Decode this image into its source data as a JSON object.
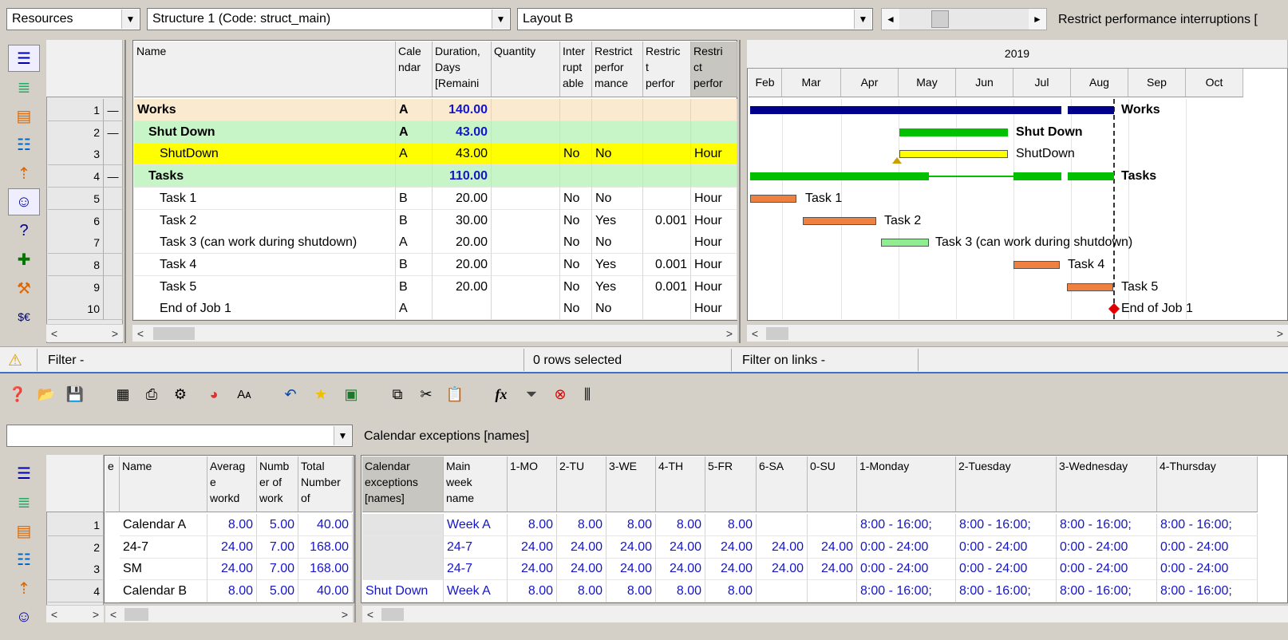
{
  "top": {
    "resources_combo": "Resources",
    "structure_combo": "Structure 1 (Code: struct_main)",
    "layout_combo": "Layout B",
    "restrict_label": "Restrict performance interruptions ["
  },
  "grid1": {
    "headers": [
      "Name",
      "Cale\nndar",
      "Duration,\nDays\n[Remaini",
      "Quantity",
      "Inter\nrupt\nable",
      "Restrict\nperfor\nmance",
      "Restric\nt\nperfor",
      "Restri\nct\nperfor"
    ],
    "rows": [
      {
        "n": "1",
        "c": "—",
        "name": "Works",
        "cal": "A",
        "dur": "140.00",
        "int": "",
        "rp": "",
        "rt": "",
        "unit": ""
      },
      {
        "n": "2",
        "c": "—",
        "name": "Shut Down",
        "cal": "A",
        "dur": "43.00",
        "int": "",
        "rp": "",
        "rt": "",
        "unit": ""
      },
      {
        "n": "3",
        "c": "",
        "name": "ShutDown",
        "cal": "A",
        "dur": "43.00",
        "int": "No",
        "rp": "No",
        "rt": "",
        "unit": "Hour"
      },
      {
        "n": "4",
        "c": "—",
        "name": "Tasks",
        "cal": "",
        "dur": "110.00",
        "int": "",
        "rp": "",
        "rt": "",
        "unit": ""
      },
      {
        "n": "5",
        "c": "",
        "name": "Task 1",
        "cal": "B",
        "dur": "20.00",
        "int": "No",
        "rp": "No",
        "rt": "",
        "unit": "Hour"
      },
      {
        "n": "6",
        "c": "",
        "name": "Task 2",
        "cal": "B",
        "dur": "30.00",
        "int": "No",
        "rp": "Yes",
        "rt": "0.001",
        "unit": "Hour"
      },
      {
        "n": "7",
        "c": "",
        "name": "Task 3 (can work during shutdown)",
        "cal": "A",
        "dur": "20.00",
        "int": "No",
        "rp": "No",
        "rt": "",
        "unit": "Hour"
      },
      {
        "n": "8",
        "c": "",
        "name": "Task 4",
        "cal": "B",
        "dur": "20.00",
        "int": "No",
        "rp": "Yes",
        "rt": "0.001",
        "unit": "Hour"
      },
      {
        "n": "9",
        "c": "",
        "name": "Task 5",
        "cal": "B",
        "dur": "20.00",
        "int": "No",
        "rp": "Yes",
        "rt": "0.001",
        "unit": "Hour"
      },
      {
        "n": "10",
        "c": "",
        "name": "End of Job 1",
        "cal": "A",
        "dur": "",
        "int": "No",
        "rp": "No",
        "rt": "",
        "unit": "Hour"
      }
    ]
  },
  "gantt": {
    "year": "2019",
    "months": [
      "Feb",
      "Mar",
      "Apr",
      "May",
      "Jun",
      "Jul",
      "Aug",
      "Sep",
      "Oct"
    ],
    "labels": [
      "Works",
      "Shut Down",
      "ShutDown",
      "Tasks",
      "Task 1",
      "Task 2",
      "Task 3 (can work during shutdown)",
      "Task 4",
      "Task 5",
      "End of Job 1"
    ],
    "colors": {
      "summary": "#00008b",
      "shutdown_summary": "#00c000",
      "shutdown": "#ffff00",
      "task": "#f08040",
      "task_green": "#90ee90",
      "milestone": "#e00000"
    }
  },
  "status": {
    "filter": "Filter -",
    "rows_selected": "0 rows selected",
    "filter_links": "Filter on links -"
  },
  "toolbar": {
    "icons": [
      "help-icon",
      "open-folder-icon",
      "save-icon",
      "table-icon",
      "print-icon",
      "tools-icon",
      "chart-pie-icon",
      "font-size-icon",
      "undo-icon",
      "star-icon",
      "excel-icon",
      "copy-icon",
      "cut-icon",
      "paste-icon",
      "formula-icon",
      "filter-icon",
      "clear-filter-icon",
      "columns-icon"
    ]
  },
  "bottom": {
    "combo_value": "",
    "combo_label": "Calendar exceptions [names]",
    "left_headers": [
      "e",
      "Name",
      "Averag\ne\nworkd",
      "Numb\ner of\nwork",
      "Total\nNumber\nof"
    ],
    "right_headers": [
      "Calendar\nexceptions\n[names]",
      "Main\nweek\nname",
      "1-MO",
      "2-TU",
      "3-WE",
      "4-TH",
      "5-FR",
      "6-SA",
      "0-SU",
      "1-Monday",
      "2-Tuesday",
      "3-Wednesday",
      "4-Thursday"
    ],
    "rows": [
      {
        "n": "1",
        "name": "Calendar A",
        "avg": "8.00",
        "num": "5.00",
        "total": "40.00",
        "exc": "",
        "week": "Week A",
        "mo": "8.00",
        "tu": "8.00",
        "we": "8.00",
        "th": "8.00",
        "fr": "8.00",
        "sa": "",
        "su": "",
        "mon": "8:00 - 16:00;",
        "tue": "8:00 - 16:00;",
        "wed": "8:00 - 16:00;",
        "thu": "8:00 - 16:00;"
      },
      {
        "n": "2",
        "name": "24-7",
        "avg": "24.00",
        "num": "7.00",
        "total": "168.00",
        "exc": "",
        "week": "24-7",
        "mo": "24.00",
        "tu": "24.00",
        "we": "24.00",
        "th": "24.00",
        "fr": "24.00",
        "sa": "24.00",
        "su": "24.00",
        "mon": "0:00 - 24:00",
        "tue": "0:00 - 24:00",
        "wed": "0:00 - 24:00",
        "thu": "0:00 - 24:00"
      },
      {
        "n": "3",
        "name": "SM",
        "avg": "24.00",
        "num": "7.00",
        "total": "168.00",
        "exc": "",
        "week": "24-7",
        "mo": "24.00",
        "tu": "24.00",
        "we": "24.00",
        "th": "24.00",
        "fr": "24.00",
        "sa": "24.00",
        "su": "24.00",
        "mon": "0:00 - 24:00",
        "tue": "0:00 - 24:00",
        "wed": "0:00 - 24:00",
        "thu": "0:00 - 24:00"
      },
      {
        "n": "4",
        "name": "Calendar B",
        "avg": "8.00",
        "num": "5.00",
        "total": "40.00",
        "exc": "Shut Down",
        "week": "Week A",
        "mo": "8.00",
        "tu": "8.00",
        "we": "8.00",
        "th": "8.00",
        "fr": "8.00",
        "sa": "",
        "su": "",
        "mon": "8:00 - 16:00;",
        "tue": "8:00 - 16:00;",
        "wed": "8:00 - 16:00;",
        "thu": "8:00 - 16:00;"
      }
    ]
  }
}
